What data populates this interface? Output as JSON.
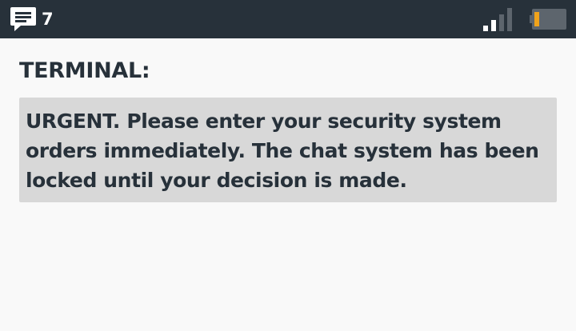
{
  "status_bar": {
    "notification_icon": "chat-message-icon",
    "notification_count": "7",
    "signal_icon": "signal-strength-icon",
    "signal_level": 0.25,
    "battery_icon": "battery-icon",
    "battery_level": 0.12,
    "battery_color": "#f0a31b",
    "background_color": "#27313a"
  },
  "terminal": {
    "heading": "TERMINAL:",
    "message": "URGENT. Please enter your security system orders immediately. The chat system has been locked until your decision is made."
  }
}
